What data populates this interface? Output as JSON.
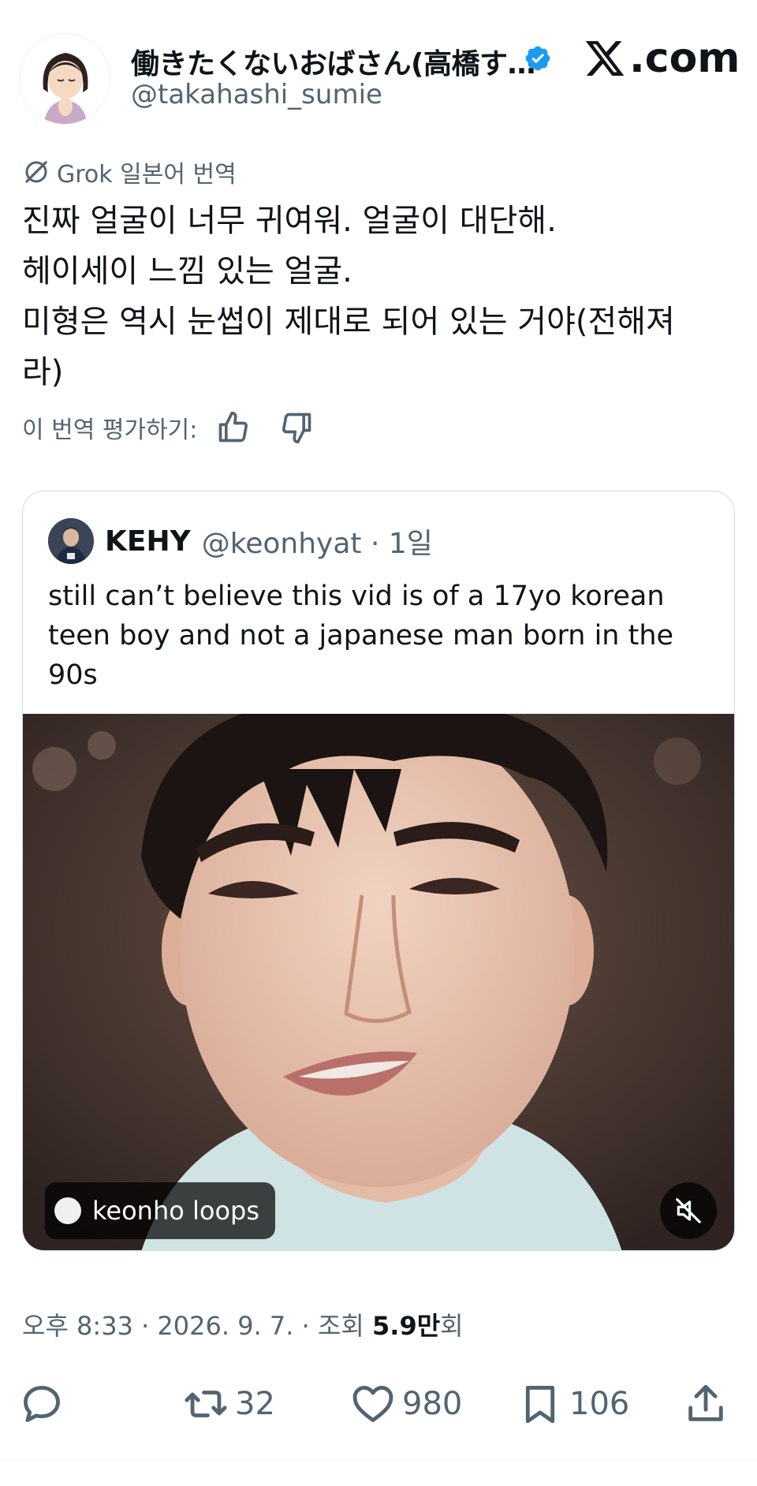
{
  "author": {
    "display_name": "働きたくないおばさん(高橋す…",
    "handle": "@takahashi_sumie",
    "verified": true
  },
  "site_logo_text": ".com",
  "translation": {
    "label": "Grok 일본어 번역",
    "lines": [
      "진짜 얼굴이 너무 귀여워. 얼굴이 대단해.",
      "헤이세이 느낌 있는 얼굴.",
      "미형은 역시 눈썹이 제대로 되어 있는 거야(전해져",
      "라)"
    ],
    "rate_label": "이 번역 평가하기:"
  },
  "quote": {
    "name": "KEHY",
    "handle_time": "@keonhyat · 1일",
    "text_lines": [
      "still can’t believe this vid is of a 17yo korean",
      "teen boy and not a japanese man born in the",
      "90s"
    ],
    "media_tag": "keonho loops"
  },
  "meta": {
    "prefix": "오후 8:33 · 2026. 9. 7. · 조회 ",
    "views": "5.9만",
    "suffix": "회"
  },
  "actions": {
    "reply": "",
    "retweets": "32",
    "likes": "980",
    "bookmarks": "106"
  },
  "colors": {
    "text": "#0f1419",
    "secondary": "#536471",
    "verified": "#1d9bf0",
    "border": "#cfd9de"
  }
}
